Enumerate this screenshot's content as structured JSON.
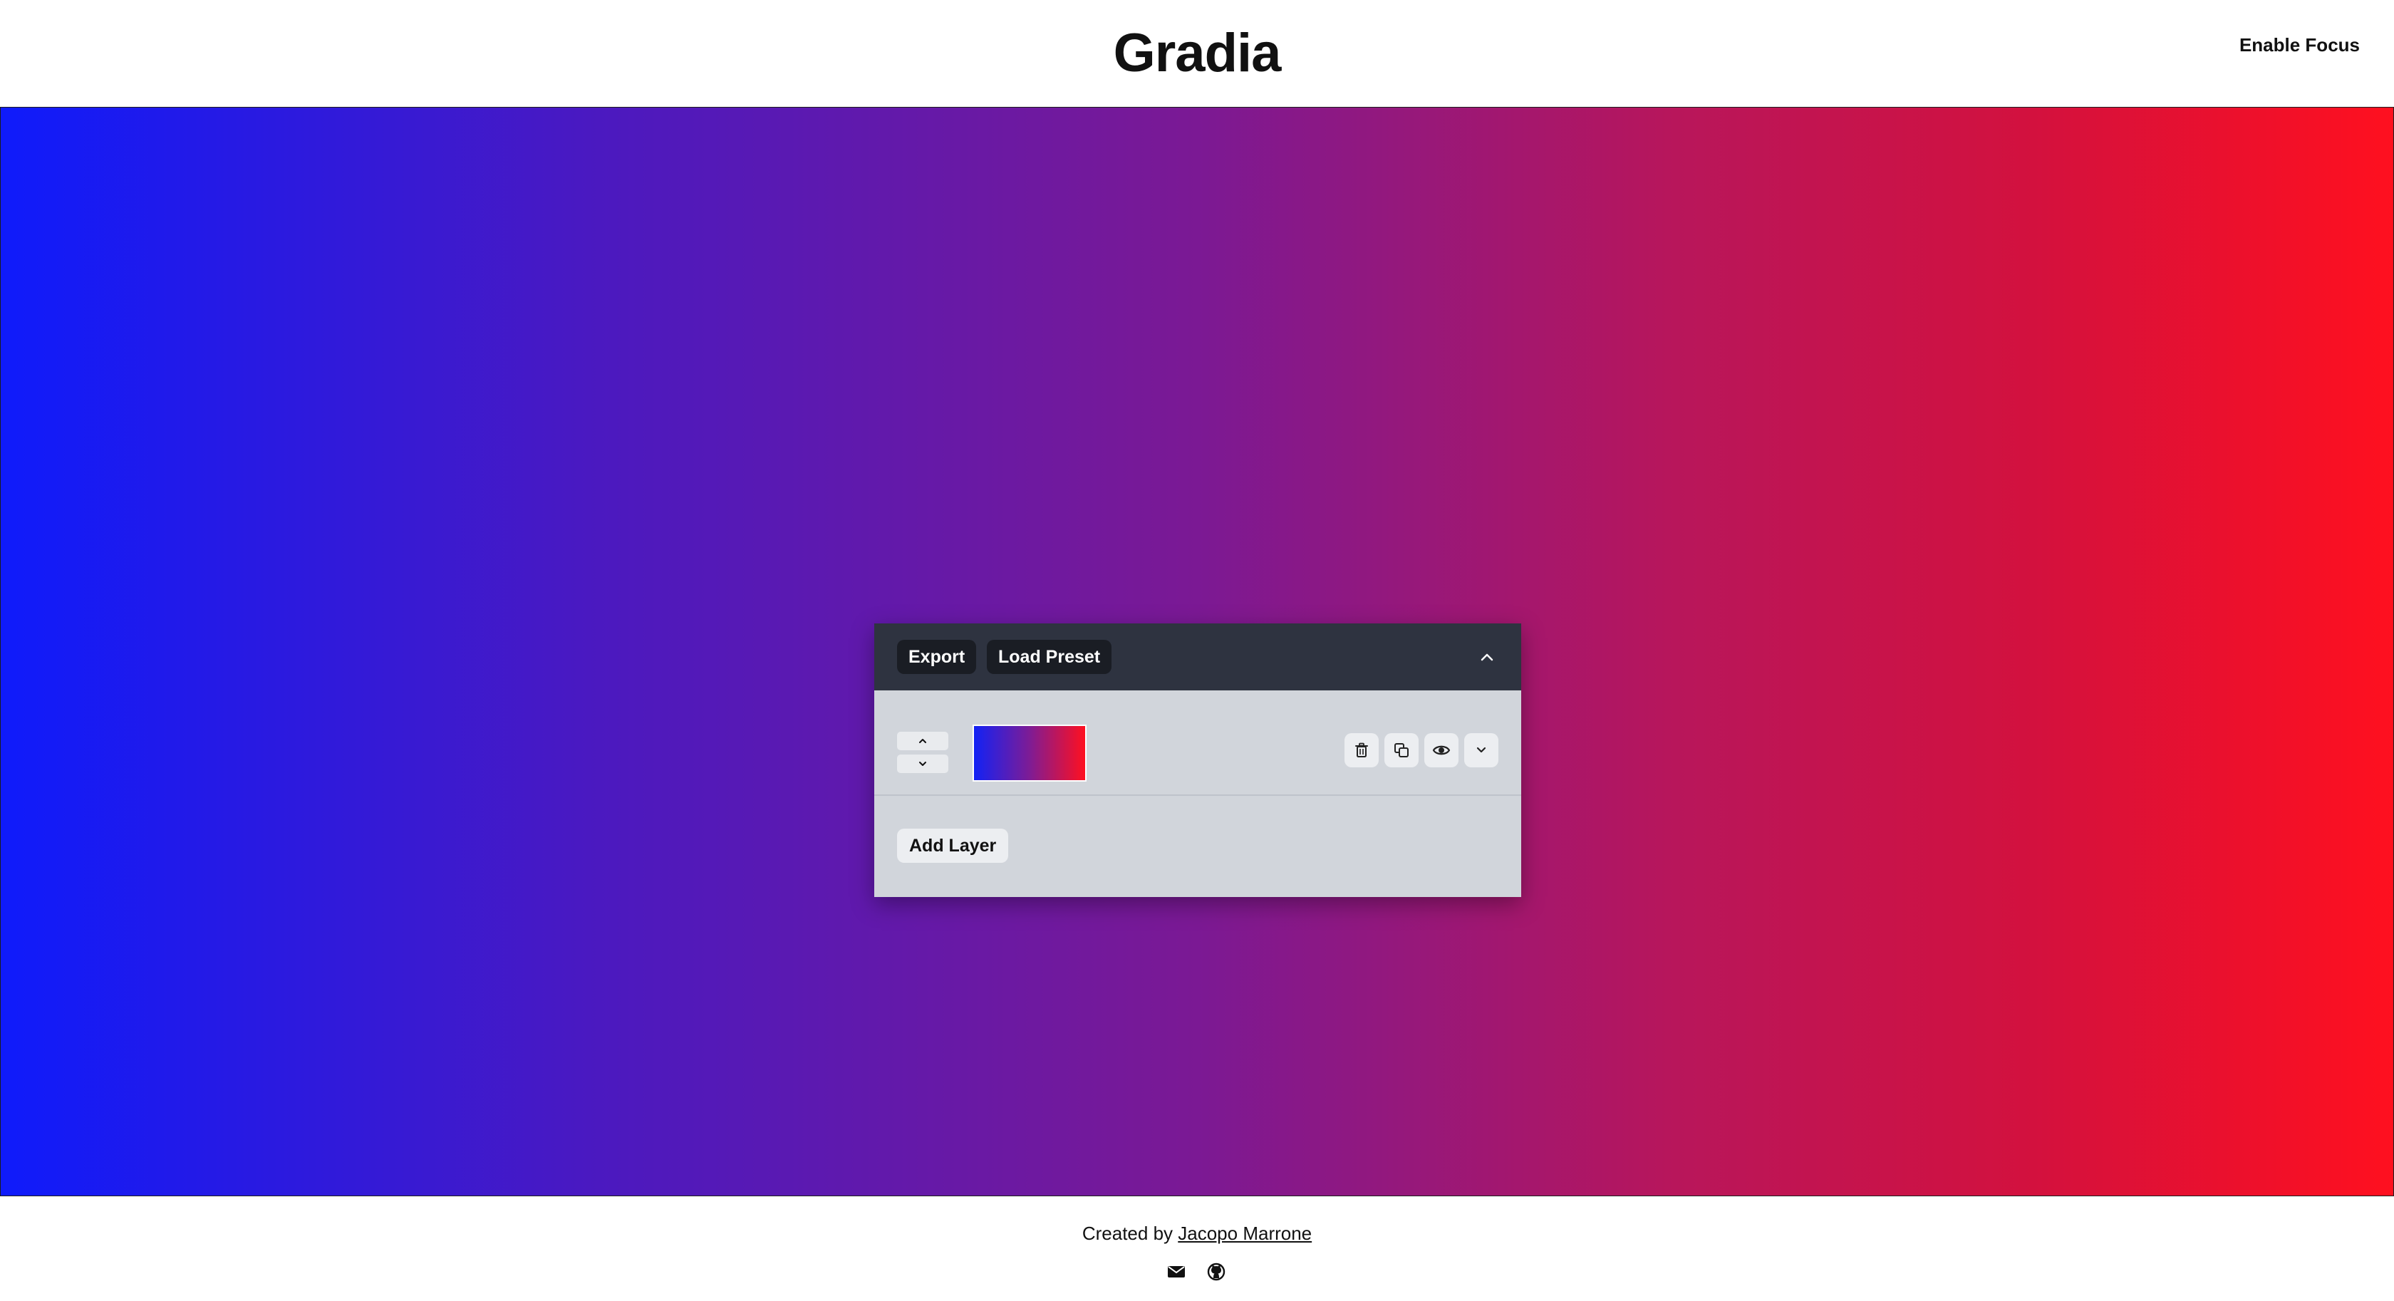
{
  "header": {
    "title": "Gradia",
    "focus_label": "Enable Focus"
  },
  "canvas": {
    "gradient_colors": [
      "#0f1bfb",
      "#7b1994",
      "#ff101f"
    ]
  },
  "panel": {
    "export_label": "Export",
    "load_preset_label": "Load Preset",
    "collapse_icon": "chevron-up-icon",
    "layers": [
      {
        "swatch_colors": [
          "#1222f5",
          "#ff1020"
        ],
        "actions": [
          "trash-icon",
          "duplicate-icon",
          "eye-icon",
          "chevron-down-icon"
        ]
      }
    ],
    "add_layer_label": "Add Layer"
  },
  "footer": {
    "credit_prefix": "Created by",
    "author": "Jacopo Marrone",
    "social_icons": [
      "mail-icon",
      "github-icon"
    ]
  }
}
